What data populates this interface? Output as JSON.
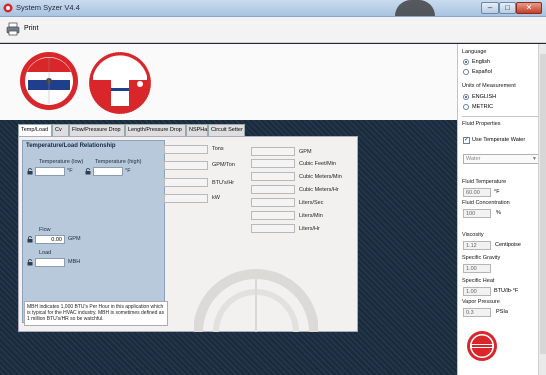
{
  "window": {
    "title": "System Syzer V4.4",
    "minimize": "–",
    "maximize": "□",
    "close": "✕"
  },
  "toolbar": {
    "print_label": "Print"
  },
  "tabs": [
    "Temp/Load",
    "Cv",
    "Flow/Pressure Drop",
    "Length/Pressure Drop",
    "NSPHa",
    "Circuit Setter"
  ],
  "tl": {
    "header": "Temperature/Load Relationship",
    "temp_low_label": "Temperature (low)",
    "temp_high_label": "Temperature (high)",
    "temp_unit": "°F",
    "temp_low_value": "",
    "temp_high_value": "",
    "flow_label": "Flow",
    "flow_value": "0.00",
    "flow_unit": "GPM",
    "load_label": "Load",
    "load_value": "",
    "load_unit": "MBH",
    "note": "MBH indicates 1,000 BTU's Per Hour in this application which is typical for the HVAC industry.   MBH is sometimes defined as 1 million BTU's/HR so be watchful."
  },
  "outputs_left": [
    "Tons",
    "GPM/Ton",
    "BTU's/Hr",
    "kW"
  ],
  "outputs_right": [
    "GPM",
    "Cubic Feet/Min",
    "Cubic Meters/Min",
    "Cubic Meters/Hr",
    "Liters/Sec",
    "Liters/Min",
    "Liters/Hr"
  ],
  "right": {
    "language_label": "Language",
    "lang_options": [
      "English",
      "Español"
    ],
    "units_label": "Units of Measurement",
    "unit_options": [
      "ENGLISH",
      "METRIC"
    ],
    "fluid_props_label": "Fluid Properties",
    "use_temp_water_label": "Use Temperate Water",
    "fluid_select": "Water",
    "fluid_temp_label": "Fluid Temperature",
    "fluid_temp_value": "60.00",
    "fluid_temp_unit": "°F",
    "fluid_conc_label": "Fluid Concentration",
    "fluid_conc_value": "100",
    "fluid_conc_unit": "%",
    "viscosity_label": "Viscosity",
    "viscosity_value": "1.12",
    "viscosity_unit": "Centipoise",
    "sg_label": "Specific Gravity",
    "sg_value": "1.00",
    "sh_label": "Specific Heat",
    "sh_value": "1.00",
    "sh_unit": "BTU/lb·°F",
    "vp_label": "Vapor Pressure",
    "vp_value": "0.3",
    "vp_unit": "PSIa"
  },
  "colors": {
    "accent_red": "#d8262b",
    "panel_blue": "#b8c9dc",
    "bg_dark": "#1d2b3a"
  }
}
